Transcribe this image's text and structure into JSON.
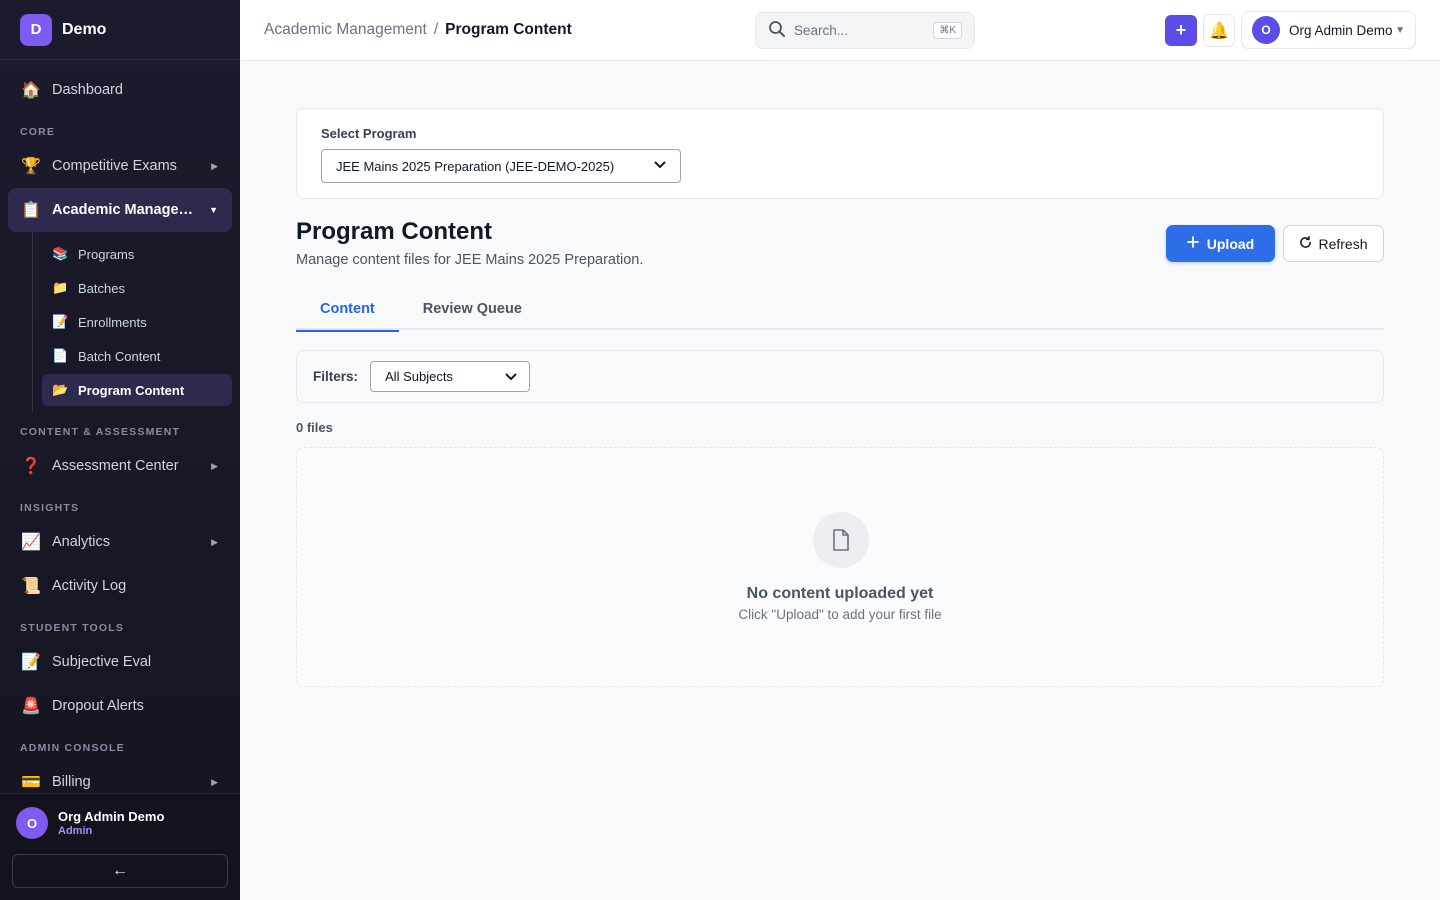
{
  "brand": {
    "initial": "D",
    "name": "Demo"
  },
  "sidebar": {
    "dashboard": {
      "icon": "🏠",
      "label": "Dashboard"
    },
    "sections": {
      "core": "CORE",
      "content": "CONTENT & ASSESSMENT",
      "insights": "INSIGHTS",
      "student_tools": "STUDENT TOOLS",
      "admin": "ADMIN CONSOLE"
    },
    "items": {
      "competitive_exams": {
        "icon": "🏆",
        "label": "Competitive Exams"
      },
      "academic_management": {
        "icon": "📋",
        "label": "Academic Manage…"
      },
      "assessment_center": {
        "icon": "❓",
        "label": "Assessment Center"
      },
      "analytics": {
        "icon": "📈",
        "label": "Analytics"
      },
      "activity_log": {
        "icon": "📜",
        "label": "Activity Log"
      },
      "subjective_eval": {
        "icon": "📝",
        "label": "Subjective Eval"
      },
      "dropout_alerts": {
        "icon": "🚨",
        "label": "Dropout Alerts"
      },
      "billing": {
        "icon": "💳",
        "label": "Billing"
      }
    },
    "sub_items": [
      {
        "icon": "📚",
        "label": "Programs"
      },
      {
        "icon": "📁",
        "label": "Batches"
      },
      {
        "icon": "📝",
        "label": "Enrollments"
      },
      {
        "icon": "📄",
        "label": "Batch Content"
      },
      {
        "icon": "📂",
        "label": "Program Content"
      }
    ],
    "footer": {
      "initial": "O",
      "name": "Org Admin Demo",
      "role": "Admin",
      "collapse": "←"
    }
  },
  "topbar": {
    "breadcrumb": {
      "parent": "Academic Management",
      "separator": "/",
      "current": "Program Content"
    },
    "search": {
      "placeholder": "Search...",
      "shortcut": "⌘K"
    },
    "plus_label": "+",
    "user": {
      "initial": "O",
      "name": "Org Admin Demo"
    }
  },
  "program_select": {
    "label": "Select Program",
    "value": "JEE Mains 2025 Preparation (JEE-DEMO-2025)"
  },
  "page": {
    "title": "Program Content",
    "subtitle": "Manage content files for JEE Mains 2025 Preparation.",
    "upload_label": "Upload",
    "refresh_label": "Refresh"
  },
  "tabs": [
    {
      "label": "Content",
      "active": true
    },
    {
      "label": "Review Queue",
      "active": false
    }
  ],
  "filters": {
    "label": "Filters:",
    "subject_value": "All Subjects"
  },
  "file_count": "0 files",
  "empty_state": {
    "title": "No content uploaded yet",
    "subtitle": "Click \"Upload\" to add your first file"
  },
  "colors": {
    "accent": "#5b4ee8",
    "primary_button": "#2d6ee8",
    "active_tab": "#2563eb",
    "sidebar_bg": "#1c1b2e"
  }
}
